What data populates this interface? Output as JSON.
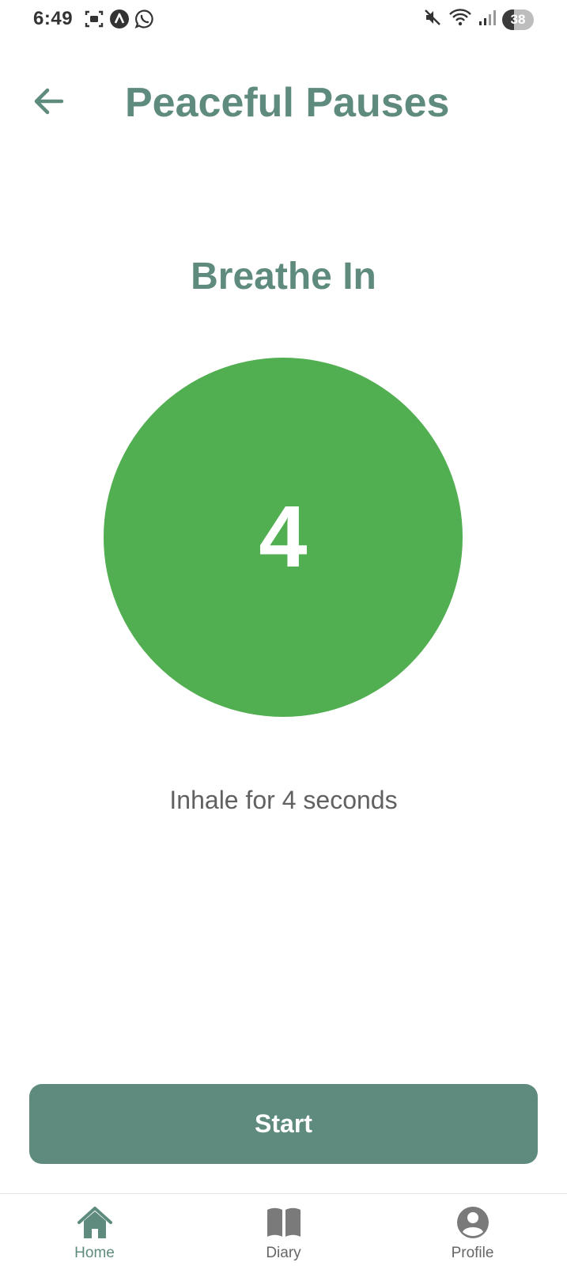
{
  "status_bar": {
    "time": "6:49",
    "left_icons": [
      "screenshot-icon",
      "app-a-icon",
      "whatsapp-icon"
    ],
    "right_icons": [
      "mute-icon",
      "wifi-icon",
      "signal-icon"
    ],
    "battery_level": "38"
  },
  "header": {
    "back_icon": "arrow-left-icon",
    "title": "Peaceful Pauses"
  },
  "breathing": {
    "phase": "Breathe In",
    "count": "4",
    "instruction": "Inhale for 4 seconds"
  },
  "actions": {
    "start_label": "Start"
  },
  "bottom_nav": {
    "items": [
      {
        "label": "Home",
        "icon": "home-icon",
        "active": true
      },
      {
        "label": "Diary",
        "icon": "book-icon",
        "active": false
      },
      {
        "label": "Profile",
        "icon": "user-circle-icon",
        "active": false
      }
    ]
  },
  "colors": {
    "primary": "#5e8b7e",
    "circle": "#51ae51",
    "text_secondary": "#616161",
    "nav_inactive": "#666666"
  }
}
